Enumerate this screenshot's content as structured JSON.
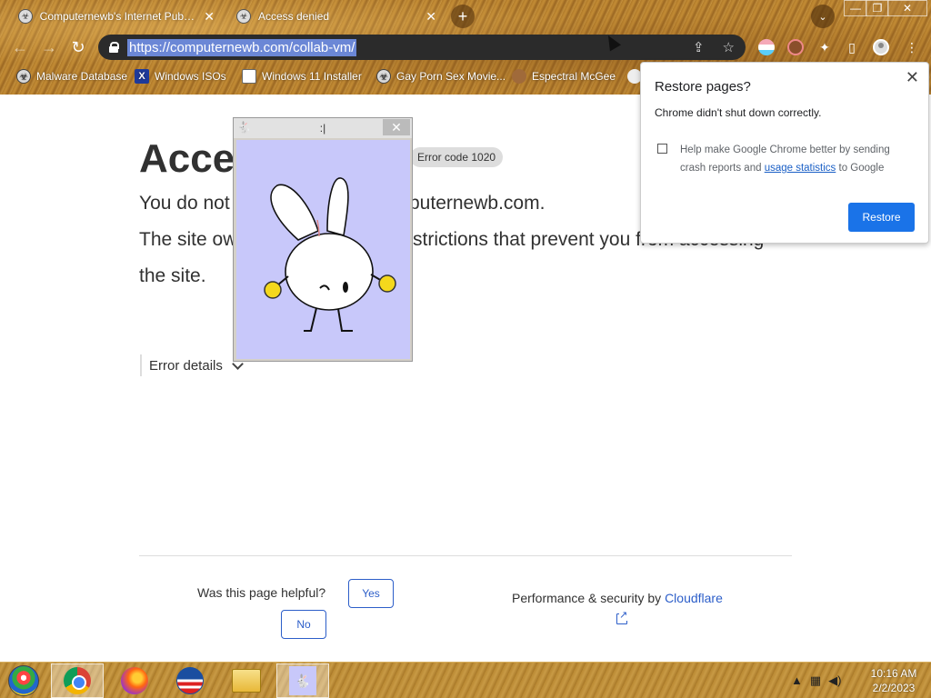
{
  "tabs": [
    {
      "title": "Computernewb's Internet Pub Hu",
      "close": "✕"
    },
    {
      "title": "Access denied",
      "close": "✕"
    }
  ],
  "new_tab": "+",
  "window_controls": {
    "minimize": "—",
    "maximize": "❐",
    "close": "✕"
  },
  "toolbar": {
    "back": "←",
    "forward": "→",
    "reload": "↻",
    "url": "https://computernewb.com/collab-vm/",
    "share": "⇪",
    "star": "☆",
    "menu": "⋮"
  },
  "bookmarks": [
    {
      "label": "Malware Database",
      "icon": "bio-icon"
    },
    {
      "label": "Windows ISOs",
      "icon": "x-icon",
      "glyph": "X"
    },
    {
      "label": "Windows 11 Installer",
      "icon": "image-icon"
    },
    {
      "label": "Gay Porn Sex Movie...",
      "icon": "bio-icon"
    },
    {
      "label": "Espectral McGee",
      "icon": "face-icon"
    }
  ],
  "page": {
    "title": "Acces",
    "error_code": "Error code 1020",
    "line1_a": "You do not",
    "line1_b": "puternewb.com.",
    "line2_a": "The site ow",
    "line2_b": "strictions that prevent you from accessing",
    "line3": "the site.",
    "error_details": "Error details",
    "helpful": "Was this page helpful?",
    "yes": "Yes",
    "no": "No",
    "perf_prefix": "Performance & security by ",
    "perf_link": "Cloudflare"
  },
  "bunny_window": {
    "title": ":|",
    "close": "✕"
  },
  "restore_dialog": {
    "title": "Restore pages?",
    "message": "Chrome didn't shut down correctly.",
    "check_text_a": "Help make Google Chrome better by sending crash reports and ",
    "check_link": "usage statistics",
    "check_text_b": " to Google",
    "button": "Restore",
    "close": "✕"
  },
  "clock": {
    "time": "10:16 AM",
    "date": "2/2/2023"
  },
  "colors": {
    "accent": "#1a73e8",
    "link": "#2c5ec9",
    "bunny_bg": "#c8c8fa"
  }
}
